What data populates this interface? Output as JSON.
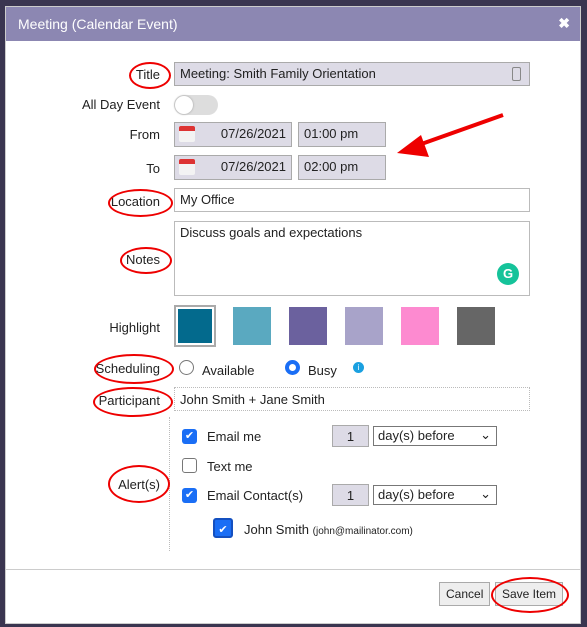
{
  "dialog": {
    "title": "Meeting (Calendar Event)",
    "close_icon": "close-icon"
  },
  "form": {
    "title_label": "Title",
    "title_value": "Meeting: Smith Family Orientation",
    "all_day_label": "All Day Event",
    "all_day_on": false,
    "from_label": "From",
    "from_date": "07/26/2021",
    "from_time": "01:00 pm",
    "to_label": "To",
    "to_date": "07/26/2021",
    "to_time": "02:00 pm",
    "location_label": "Location",
    "location_value": "My Office",
    "notes_label": "Notes",
    "notes_value": "Discuss goals and expectations",
    "highlight_label": "Highlight",
    "highlight_colors": [
      "#036a8d",
      "#5aa9c0",
      "#6b619e",
      "#a8a3c9",
      "#fd8ad0",
      "#666666"
    ],
    "scheduling_label": "Scheduling",
    "available_label": "Available",
    "busy_label": "Busy",
    "scheduling_selected": "Busy",
    "participant_label": "Participant",
    "participant_value": "John Smith + Jane Smith",
    "alerts_label": "Alert(s)",
    "email_me_label": "Email me",
    "email_me_checked": true,
    "email_me_count": "1",
    "email_me_unit": "day(s) before",
    "text_me_label": "Text me",
    "text_me_checked": false,
    "email_contacts_label": "Email Contact(s)",
    "email_contacts_checked": true,
    "email_contacts_count": "1",
    "email_contacts_unit": "day(s) before",
    "contact_name": "John Smith",
    "contact_email": "(john@mailinator.com)",
    "contact_checked": true
  },
  "footer": {
    "cancel": "Cancel",
    "save": "Save Item"
  },
  "annotation_color": "#e00000"
}
